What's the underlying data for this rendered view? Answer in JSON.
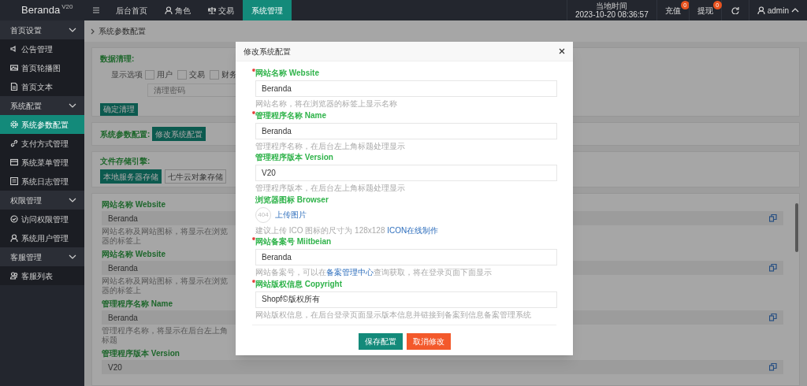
{
  "topbar": {
    "logo": "Beranda",
    "version": "V20",
    "nav": [
      {
        "label": "后台首页",
        "selected": false
      },
      {
        "label": "角色",
        "selected": false
      },
      {
        "label": "交易",
        "selected": false
      },
      {
        "label": "系统管理",
        "selected": true
      }
    ],
    "clock_label": "当地时间",
    "clock": "2023-10-20 08:36:57",
    "counters": [
      {
        "label": "充值",
        "badge": "0"
      },
      {
        "label": "提现",
        "badge": "0"
      }
    ],
    "user": "admin"
  },
  "sidebar": {
    "groups": [
      {
        "label": "首页设置",
        "expanded": true,
        "children": [
          {
            "label": "公告管理",
            "selected": false
          },
          {
            "label": "首页轮播图",
            "selected": false
          },
          {
            "label": "首页文本",
            "selected": false
          }
        ]
      },
      {
        "label": "系统配置",
        "expanded": true,
        "children": [
          {
            "label": "系统参数配置",
            "selected": true
          },
          {
            "label": "支付方式管理",
            "selected": false
          },
          {
            "label": "系统菜单管理",
            "selected": false
          },
          {
            "label": "系统日志管理",
            "selected": false
          }
        ]
      },
      {
        "label": "权限管理",
        "expanded": true,
        "children": [
          {
            "label": "访问权限管理",
            "selected": false
          },
          {
            "label": "系统用户管理",
            "selected": false
          }
        ]
      },
      {
        "label": "客服管理",
        "expanded": true,
        "children": [
          {
            "label": "客服列表",
            "selected": false
          }
        ]
      }
    ]
  },
  "breadcrumb": "系统参数配置",
  "cleanup": {
    "label": "数据清理:",
    "options_label": "显示选项",
    "options": [
      {
        "label": "用户",
        "checked": false
      },
      {
        "label": "交易",
        "checked": false
      },
      {
        "label": "财务",
        "checked": false
      }
    ],
    "password_placeholder": "清理密码",
    "button": "确定清理"
  },
  "sysconf": {
    "label": "系统参数配置:",
    "button": "修改系统配置"
  },
  "storage": {
    "label": "文件存储引擎:",
    "options": [
      {
        "label": "本地服务器存储",
        "selected": true
      },
      {
        "label": "七牛云对象存储",
        "selected": false
      }
    ]
  },
  "settings": [
    {
      "label": "网站名称 Website",
      "value": "Beranda",
      "help": "网站名称及网站图标，将显示在浏览器的标签上"
    },
    {
      "label": "网站名称 Website",
      "value": "Beranda",
      "help": "网站名称及网站图标，将显示在浏览器的标签上"
    },
    {
      "label": "管理程序名称 Name",
      "value": "Beranda",
      "help": "管理程序名称，将显示在后台左上角标题"
    },
    {
      "label": "管理程序版本 Version",
      "value": "V20"
    }
  ],
  "modal": {
    "title": "修改系统配置",
    "fields": [
      {
        "kind": "input",
        "label": "网站名称 Website",
        "required": true,
        "value": "Beranda",
        "help": [
          {
            "text": "网站名称，将在浏览器的标签上显示名称",
            "link": false
          }
        ]
      },
      {
        "kind": "input",
        "label": "管理程序名称 Name",
        "required": true,
        "value": "Beranda",
        "help": [
          {
            "text": "管理程序名称，在后台左上角标题处理显示",
            "link": false
          }
        ]
      },
      {
        "kind": "input",
        "label": "管理程序版本 Version",
        "required": false,
        "value": "V20",
        "help": [
          {
            "text": "管理程序版本，在后台左上角标题处理显示",
            "link": false
          }
        ]
      },
      {
        "kind": "upload",
        "label": "浏览器图标 Browser",
        "required": false,
        "avatar": "404",
        "upload": "上传图片",
        "help": [
          {
            "text": "建议上传 ICO 图标的尺寸为 128x128 ",
            "link": false
          },
          {
            "text": "ICON在线制作",
            "link": true
          }
        ]
      },
      {
        "kind": "input",
        "label": "网站备案号 Miitbeian",
        "required": true,
        "value": "Beranda",
        "help": [
          {
            "text": "网站备案号，可以在",
            "link": false
          },
          {
            "text": "备案管理中心",
            "link": true
          },
          {
            "text": "查询获取，将在登录页面下面显示",
            "link": false
          }
        ]
      },
      {
        "kind": "input",
        "label": "网站版权信息 Copyright",
        "required": true,
        "value": "Shopf©版权所有",
        "help": [
          {
            "text": "网站版权信息，在后台登录页面显示版本信息并链接到备案到信息备案管理系统",
            "link": false
          }
        ]
      }
    ],
    "buttons": [
      {
        "kind": "primary",
        "label": "保存配置"
      },
      {
        "kind": "danger",
        "label": "取消修改"
      }
    ]
  }
}
